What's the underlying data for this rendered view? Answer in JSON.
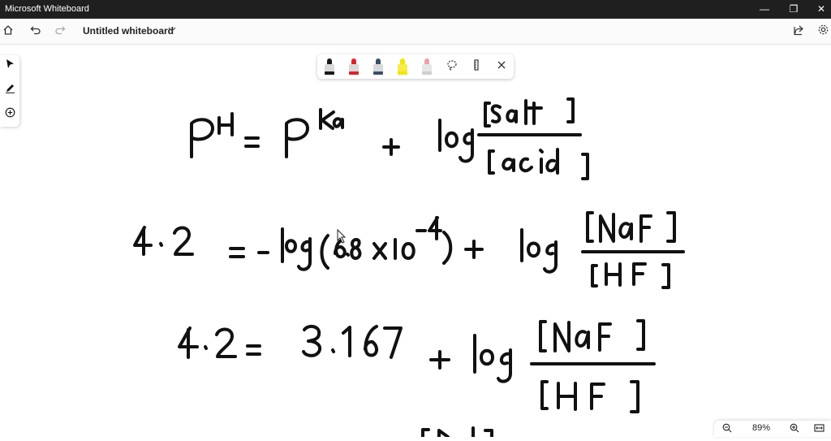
{
  "app": {
    "title": "Microsoft Whiteboard"
  },
  "window_controls": {
    "minimize": "—",
    "restore": "❐",
    "close": "✕"
  },
  "toolbar": {
    "board_title": "Untitled whiteboard"
  },
  "zoom": {
    "level": "89%"
  },
  "ink_colors": {
    "black": "#1a1a1a",
    "red": "#d9232e",
    "blue": "#3b4f6b",
    "yellow": "#f2e600",
    "eraser": "#f0a0a8"
  }
}
